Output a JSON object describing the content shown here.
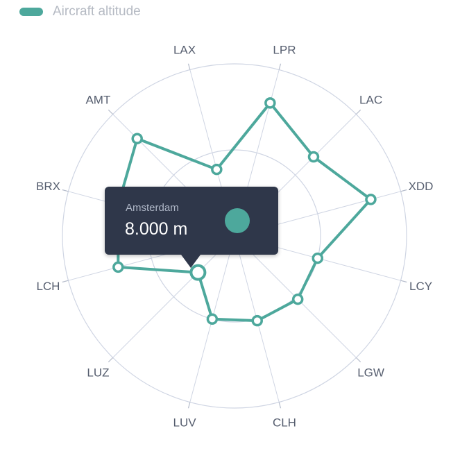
{
  "legend": {
    "label": "Aircraft altitude",
    "color": "#4da89c"
  },
  "tooltip": {
    "title": "Amsterdam",
    "value": "8.000 m"
  },
  "chart_data": {
    "type": "radar",
    "title": "",
    "categories": [
      "LPR",
      "LAC",
      "XDD",
      "LCY",
      "LGW",
      "CLH",
      "LUV",
      "LUZ",
      "LCH",
      "BRX",
      "AMT",
      "LAX"
    ],
    "series": [
      {
        "name": "Aircraft altitude",
        "color": "#4da89c",
        "values": [
          8000,
          6500,
          8200,
          5000,
          5200,
          5100,
          5000,
          3000,
          7000,
          7000,
          8000,
          4000
        ]
      }
    ],
    "rlim": [
      0,
      10000
    ],
    "rings": 2,
    "highlighted_index": 7,
    "grid": true
  }
}
